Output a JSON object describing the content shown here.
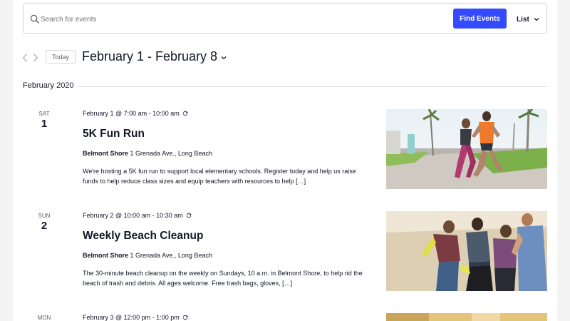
{
  "search": {
    "placeholder": "Search for events",
    "find_button": "Find Events",
    "view_label": "List",
    "icon": "search-icon"
  },
  "nav": {
    "today_label": "Today",
    "date_range": "February 1 - February 8",
    "prev_icon": "chevron-left-icon",
    "next_icon": "chevron-right-icon"
  },
  "month_label": "February 2020",
  "colors": {
    "accent": "#334aff",
    "text": "#141827",
    "muted": "#5d5d5d",
    "border": "#d5d5d5"
  },
  "events": [
    {
      "dow": "Sat",
      "day": "1",
      "when": "February 1 @ 7:00 am - 10:00 am",
      "recurring": true,
      "title": "5K Fun Run",
      "venue_name": "Belmont Shore",
      "venue_address": "1 Grenada Ave., Long Beach",
      "description": "We're hosting a 5K fun run to support local elementary schools. Register today and help us raise funds to help reduce class sizes and equip teachers with resources to help […]",
      "image": "runners-photo"
    },
    {
      "dow": "Sun",
      "day": "2",
      "when": "February 2 @ 10:00 am - 10:30 am",
      "recurring": true,
      "title": "Weekly Beach Cleanup",
      "venue_name": "Belmont Shore",
      "venue_address": "1 Grenada Ave., Long Beach",
      "description": "The 30-minute beach cleanup on the weekly on Sundays, 10 a.m. in Belmont Shore, to help rid the beach of trash and debris. All ages welcome. Free trash bags, gloves, […]",
      "image": "beach-cleanup-photo"
    },
    {
      "dow": "Mon",
      "day": "",
      "when": "February 3 @ 12:00 pm - 1:00 pm",
      "recurring": true,
      "title": "",
      "venue_name": "",
      "venue_address": "",
      "description": "",
      "image": "event-photo"
    }
  ]
}
